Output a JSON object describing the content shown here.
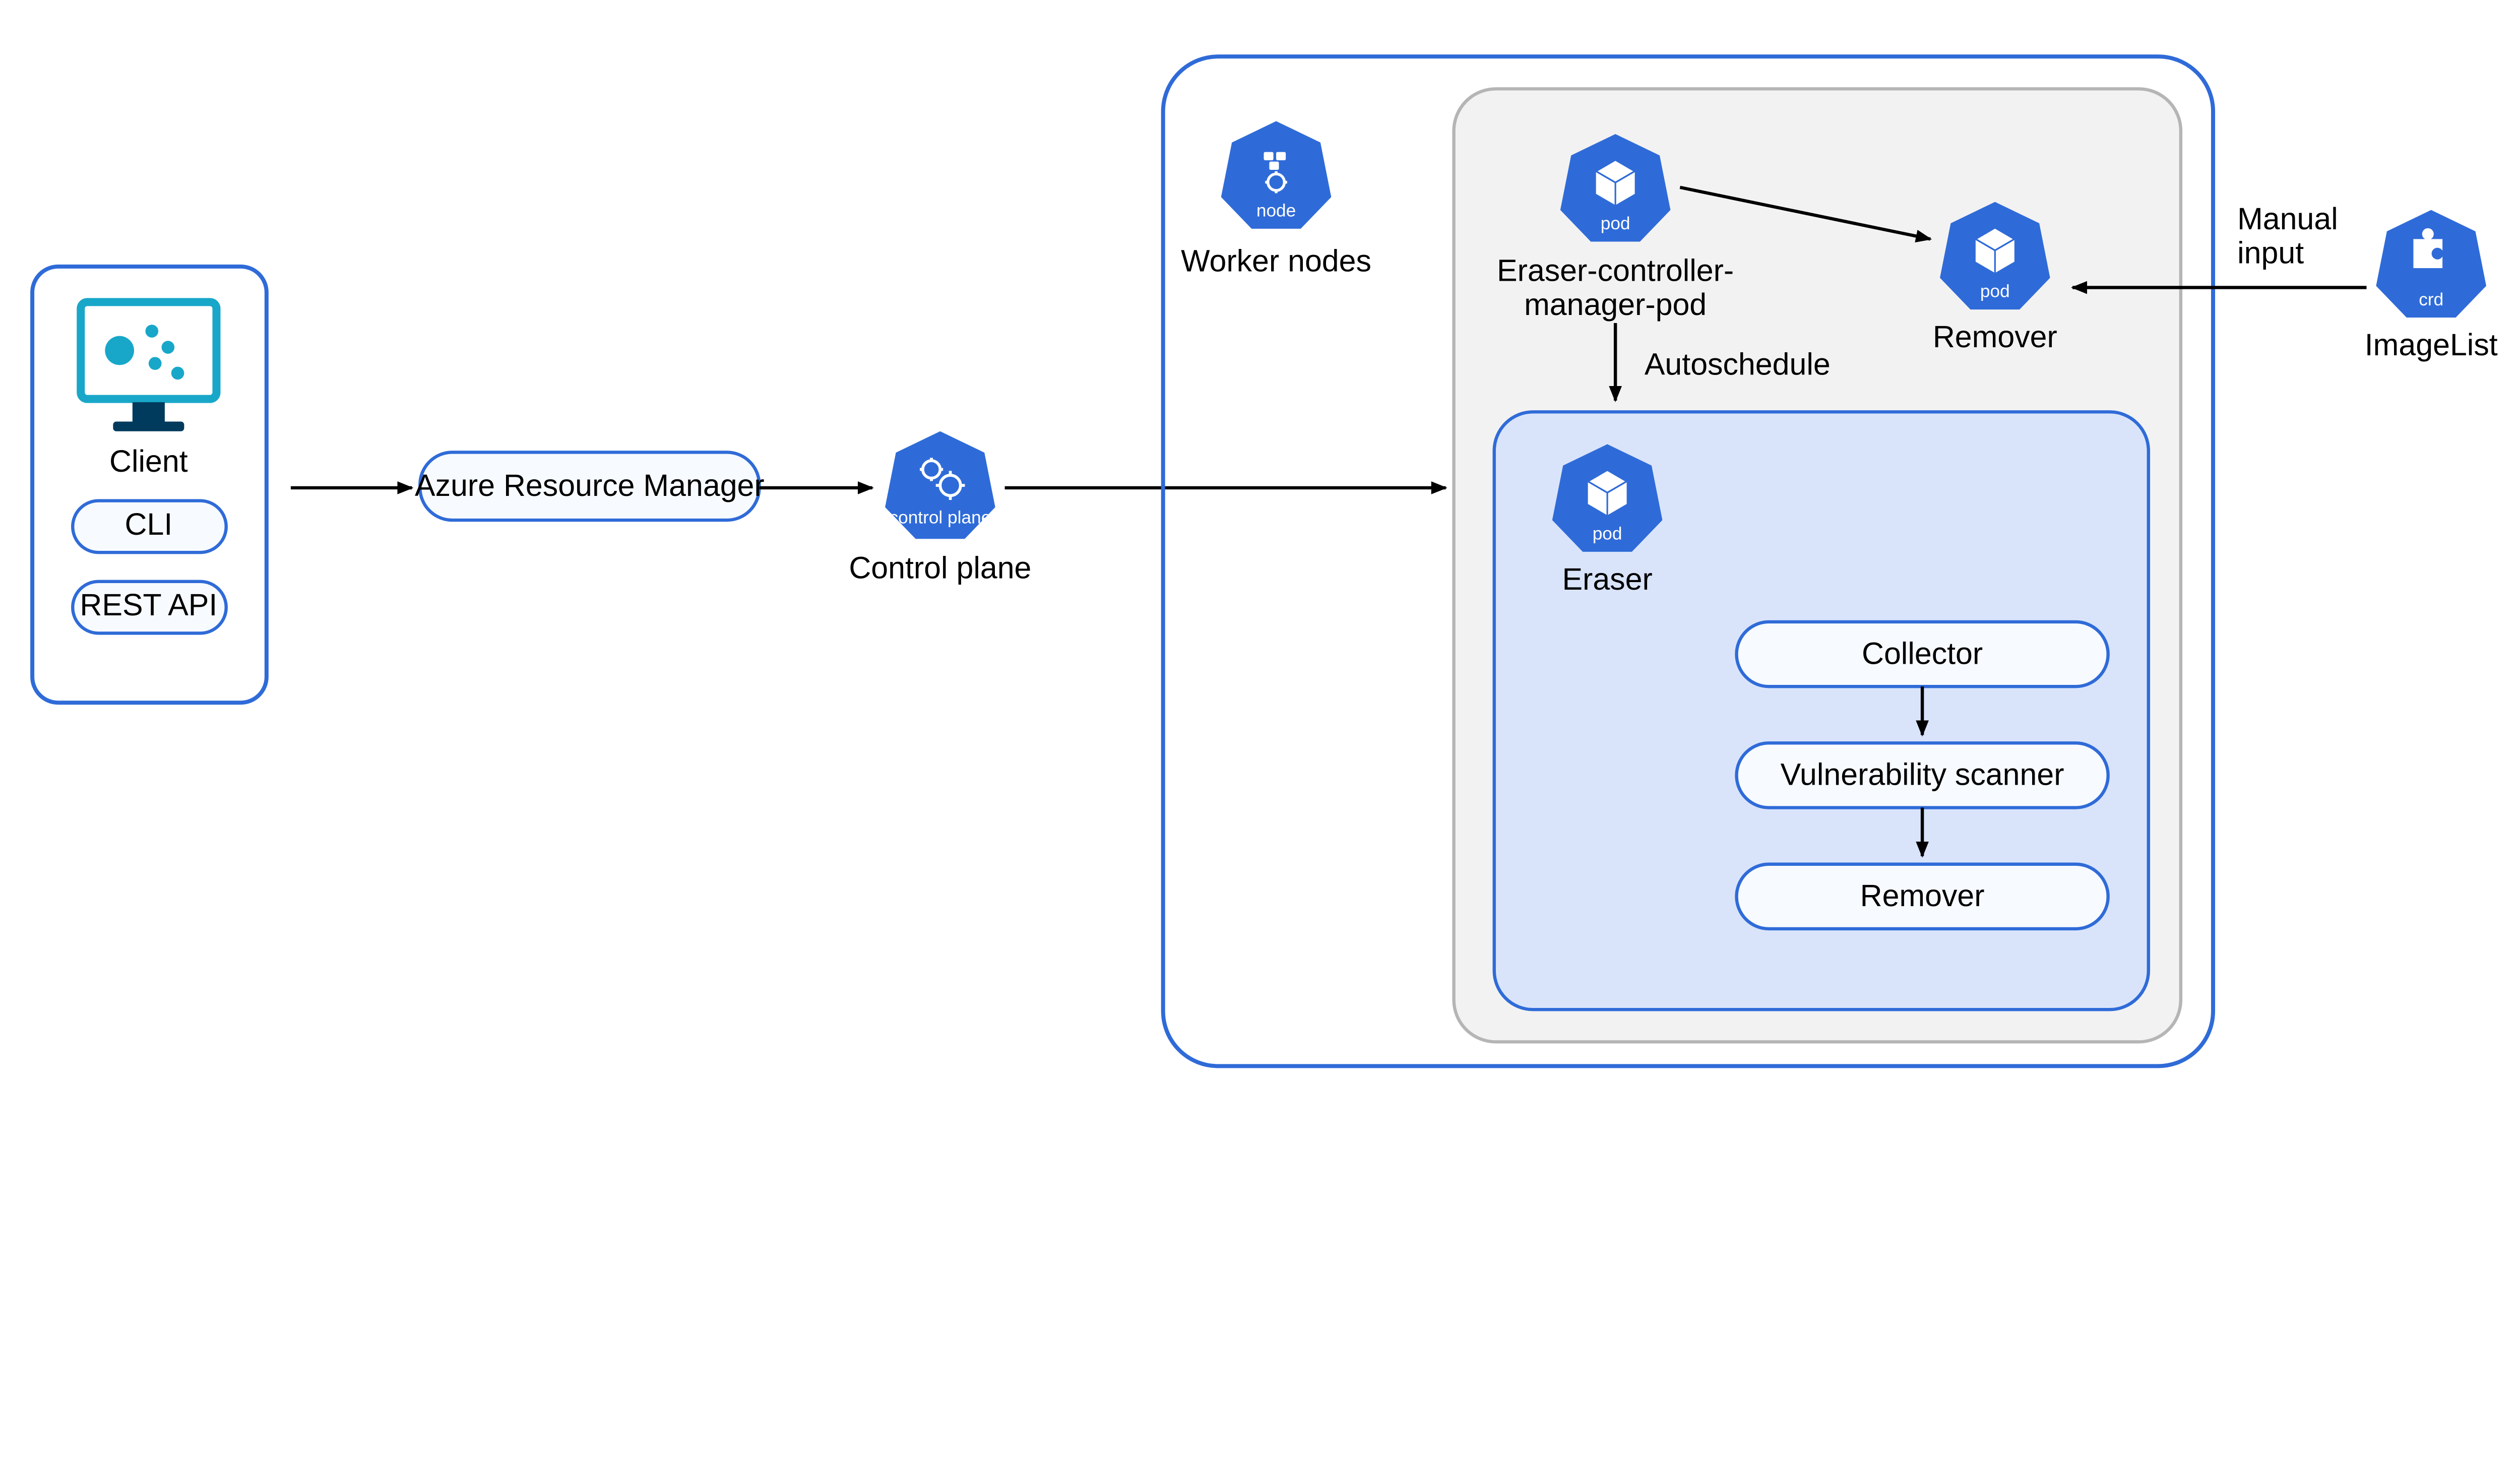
{
  "colors": {
    "azure": "#2f6bd8",
    "azureLight": "#e8efff",
    "podBlue": "#d9e4fb",
    "greyPanel": "#f2f2f2",
    "greyStroke": "#b5b5b5",
    "monitorTeal": "#18a7c9",
    "boxFill": "#f7faff"
  },
  "client": {
    "title": "Client",
    "cli": "CLI",
    "rest": "REST API"
  },
  "arm": {
    "label": "Azure Resource Manager"
  },
  "controlPlane": {
    "label": "Control plane",
    "iconLabel": "control plane"
  },
  "workerNodes": {
    "label": "Worker nodes",
    "iconLabel": "node"
  },
  "eraserController": {
    "line1": "Eraser-controller-",
    "line2": "manager-pod",
    "iconLabel": "pod"
  },
  "remover": {
    "label": "Remover",
    "iconLabel": "pod"
  },
  "autoschedule": "Autoschedule",
  "eraserPod": {
    "label": "Eraser",
    "iconLabel": "pod"
  },
  "pipeline": {
    "collector": "Collector",
    "vuln": "Vulnerability scanner",
    "remover": "Remover"
  },
  "manualInput": {
    "line1": "Manual",
    "line2": "input"
  },
  "imageList": {
    "label": "ImageList",
    "iconLabel": "crd"
  }
}
